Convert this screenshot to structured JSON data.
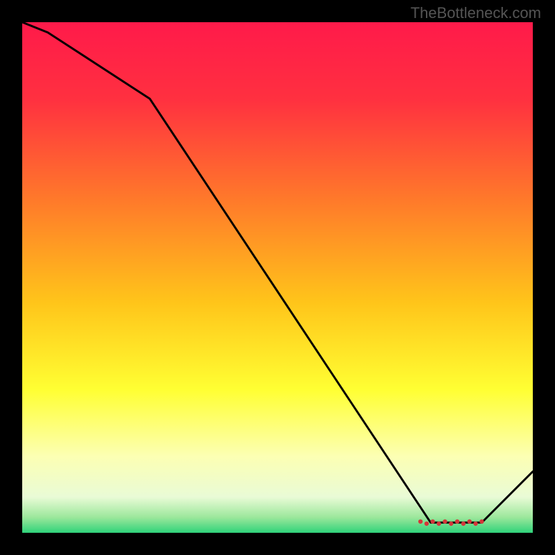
{
  "watermark": "TheBottleneck.com",
  "chart_data": {
    "type": "line",
    "title": "",
    "xlabel": "",
    "ylabel": "",
    "xlim": [
      0,
      100
    ],
    "ylim": [
      0,
      100
    ],
    "x": [
      0,
      5,
      25,
      80,
      90,
      100
    ],
    "values": [
      100,
      98,
      85,
      2,
      2,
      12
    ],
    "marker_band": {
      "x_start": 78,
      "x_end": 90,
      "y": 2
    },
    "gradient_stops": [
      {
        "pos": 0.0,
        "color": "#ff1a4a"
      },
      {
        "pos": 0.15,
        "color": "#ff3040"
      },
      {
        "pos": 0.35,
        "color": "#ff7a2a"
      },
      {
        "pos": 0.55,
        "color": "#ffc51a"
      },
      {
        "pos": 0.72,
        "color": "#ffff33"
      },
      {
        "pos": 0.85,
        "color": "#fcffb3"
      },
      {
        "pos": 0.93,
        "color": "#e9fbd6"
      },
      {
        "pos": 0.97,
        "color": "#9be79b"
      },
      {
        "pos": 1.0,
        "color": "#2fd37a"
      }
    ]
  }
}
